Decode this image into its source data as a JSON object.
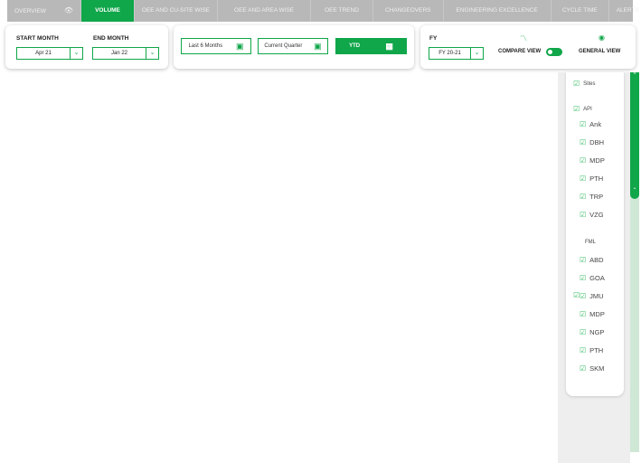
{
  "tabs": [
    {
      "label": "OVERVIEW",
      "icon": "eye-icon"
    },
    {
      "label": "VOLUME",
      "active": true
    },
    {
      "label": "OEE AND CU-SITE WISE"
    },
    {
      "label": "OEE AND AREA WISE"
    },
    {
      "label": "OEE TREND"
    },
    {
      "label": "CHANGEOVERS"
    },
    {
      "label": "ENGINEERING EXCELLENCE"
    },
    {
      "label": "CYCLE TIME"
    },
    {
      "label": "ALERTS"
    }
  ],
  "filters": {
    "start_month_label": "START MONTH",
    "start_month_value": "Apr 21",
    "end_month_label": "END MONTH",
    "end_month_value": "Jan 22",
    "last6": "Last 6 Months",
    "current_quarter": "Current Quarter",
    "ytd": "YTD",
    "fy_label": "FY",
    "fy_value": "FY 20-21",
    "compare_view": "COMPARE VIEW",
    "general_view": "GENERAL VIEW"
  },
  "sidebar": {
    "sites": "Sites",
    "groups": [
      {
        "name": "API",
        "items": [
          "Ank",
          "DBH",
          "MDP",
          "PTH",
          "TRP",
          "VZG"
        ]
      },
      {
        "name": "FML",
        "items": [
          "ABD",
          "GOA",
          "JMU",
          "MDP",
          "NGP",
          "PTH",
          "SKM"
        ]
      }
    ]
  },
  "colors": {
    "accent": "#10a64a"
  }
}
